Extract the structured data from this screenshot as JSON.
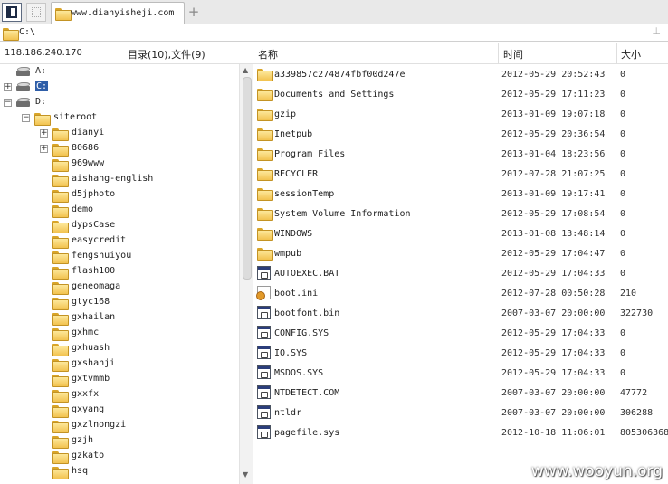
{
  "tab": {
    "title": "www.dianyisheji.com",
    "new_tab": "+"
  },
  "address": {
    "path": "C:\\",
    "pin": "⊥"
  },
  "info": {
    "ip": "118.186.240.170",
    "count": "目录(10),文件(9)"
  },
  "columns": {
    "name": "名称",
    "time": "时间",
    "size": "大小"
  },
  "tree": [
    {
      "label": "A:",
      "type": "drive",
      "level": 0,
      "expander": ""
    },
    {
      "label": "C:",
      "type": "drive",
      "level": 0,
      "expander": "+",
      "selected": true
    },
    {
      "label": "D:",
      "type": "drive",
      "level": 0,
      "expander": "−"
    },
    {
      "label": "siteroot",
      "type": "folder",
      "level": 1,
      "expander": "−"
    },
    {
      "label": "dianyi",
      "type": "folder",
      "level": 2,
      "expander": "+"
    },
    {
      "label": "80686",
      "type": "folder",
      "level": 2,
      "expander": "+"
    },
    {
      "label": "969www",
      "type": "folder",
      "level": 2,
      "expander": ""
    },
    {
      "label": "aishang-english",
      "type": "folder",
      "level": 2,
      "expander": ""
    },
    {
      "label": "d5jphoto",
      "type": "folder",
      "level": 2,
      "expander": ""
    },
    {
      "label": "demo",
      "type": "folder",
      "level": 2,
      "expander": ""
    },
    {
      "label": "dypsCase",
      "type": "folder",
      "level": 2,
      "expander": ""
    },
    {
      "label": "easycredit",
      "type": "folder",
      "level": 2,
      "expander": ""
    },
    {
      "label": "fengshuiyou",
      "type": "folder",
      "level": 2,
      "expander": ""
    },
    {
      "label": "flash100",
      "type": "folder",
      "level": 2,
      "expander": ""
    },
    {
      "label": "geneomaga",
      "type": "folder",
      "level": 2,
      "expander": ""
    },
    {
      "label": "gtyc168",
      "type": "folder",
      "level": 2,
      "expander": ""
    },
    {
      "label": "gxhailan",
      "type": "folder",
      "level": 2,
      "expander": ""
    },
    {
      "label": "gxhmc",
      "type": "folder",
      "level": 2,
      "expander": ""
    },
    {
      "label": "gxhuash",
      "type": "folder",
      "level": 2,
      "expander": ""
    },
    {
      "label": "gxshanji",
      "type": "folder",
      "level": 2,
      "expander": ""
    },
    {
      "label": "gxtvmmb",
      "type": "folder",
      "level": 2,
      "expander": ""
    },
    {
      "label": "gxxfx",
      "type": "folder",
      "level": 2,
      "expander": ""
    },
    {
      "label": "gxyang",
      "type": "folder",
      "level": 2,
      "expander": ""
    },
    {
      "label": "gxzlnongzi",
      "type": "folder",
      "level": 2,
      "expander": ""
    },
    {
      "label": "gzjh",
      "type": "folder",
      "level": 2,
      "expander": ""
    },
    {
      "label": "gzkato",
      "type": "folder",
      "level": 2,
      "expander": ""
    },
    {
      "label": "hsq",
      "type": "folder",
      "level": 2,
      "expander": ""
    }
  ],
  "files": [
    {
      "name": "a339857c274874fbf00d247e",
      "time": "2012-05-29 20:52:43",
      "size": "0",
      "icon": "folder-icon"
    },
    {
      "name": "Documents and Settings",
      "time": "2012-05-29 17:11:23",
      "size": "0",
      "icon": "folder-icon"
    },
    {
      "name": "gzip",
      "time": "2013-01-09 19:07:18",
      "size": "0",
      "icon": "folder-icon"
    },
    {
      "name": "Inetpub",
      "time": "2012-05-29 20:36:54",
      "size": "0",
      "icon": "folder-icon"
    },
    {
      "name": "Program Files",
      "time": "2013-01-04 18:23:56",
      "size": "0",
      "icon": "folder-icon"
    },
    {
      "name": "RECYCLER",
      "time": "2012-07-28 21:07:25",
      "size": "0",
      "icon": "folder-icon"
    },
    {
      "name": "sessionTemp",
      "time": "2013-01-09 19:17:41",
      "size": "0",
      "icon": "folder-icon"
    },
    {
      "name": "System Volume Information",
      "time": "2012-05-29 17:08:54",
      "size": "0",
      "icon": "folder-icon"
    },
    {
      "name": "WINDOWS",
      "time": "2013-01-08 13:48:14",
      "size": "0",
      "icon": "folder-icon"
    },
    {
      "name": "wmpub",
      "time": "2012-05-29 17:04:47",
      "size": "0",
      "icon": "folder-icon"
    },
    {
      "name": "AUTOEXEC.BAT",
      "time": "2012-05-29 17:04:33",
      "size": "0",
      "icon": "system-file-icon"
    },
    {
      "name": "boot.ini",
      "time": "2012-07-28 00:50:28",
      "size": "210",
      "icon": "config-file-icon"
    },
    {
      "name": "bootfont.bin",
      "time": "2007-03-07 20:00:00",
      "size": "322730",
      "icon": "system-file-icon"
    },
    {
      "name": "CONFIG.SYS",
      "time": "2012-05-29 17:04:33",
      "size": "0",
      "icon": "system-file-icon"
    },
    {
      "name": "IO.SYS",
      "time": "2012-05-29 17:04:33",
      "size": "0",
      "icon": "system-file-icon"
    },
    {
      "name": "MSDOS.SYS",
      "time": "2012-05-29 17:04:33",
      "size": "0",
      "icon": "system-file-icon"
    },
    {
      "name": "NTDETECT.COM",
      "time": "2007-03-07 20:00:00",
      "size": "47772",
      "icon": "system-file-icon"
    },
    {
      "name": "ntldr",
      "time": "2007-03-07 20:00:00",
      "size": "306288",
      "icon": "system-file-icon"
    },
    {
      "name": "pagefile.sys",
      "time": "2012-10-18 11:06:01",
      "size": "805306368",
      "icon": "system-file-icon"
    }
  ],
  "watermark": "www.wooyun.org",
  "colors": {
    "selection": "#2f5ea8",
    "folder": "#f2c24f"
  }
}
